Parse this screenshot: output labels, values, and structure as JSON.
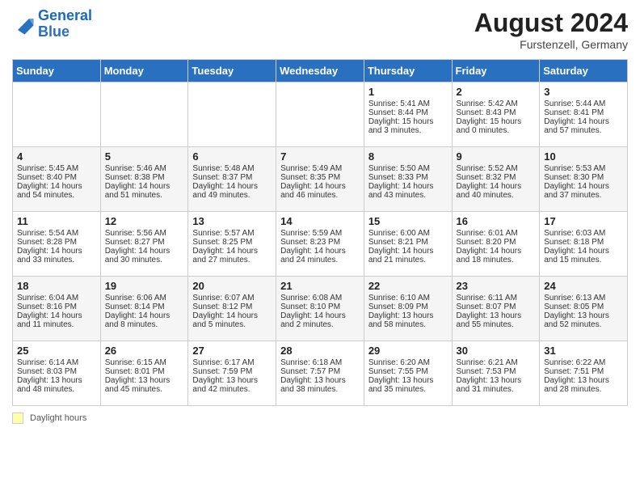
{
  "header": {
    "logo_general": "General",
    "logo_blue": "Blue",
    "month_year": "August 2024",
    "location": "Furstenzell, Germany"
  },
  "days_of_week": [
    "Sunday",
    "Monday",
    "Tuesday",
    "Wednesday",
    "Thursday",
    "Friday",
    "Saturday"
  ],
  "footer": {
    "label": "Daylight hours"
  },
  "weeks": [
    [
      {
        "day": "",
        "sunrise": "",
        "sunset": "",
        "daylight": ""
      },
      {
        "day": "",
        "sunrise": "",
        "sunset": "",
        "daylight": ""
      },
      {
        "day": "",
        "sunrise": "",
        "sunset": "",
        "daylight": ""
      },
      {
        "day": "",
        "sunrise": "",
        "sunset": "",
        "daylight": ""
      },
      {
        "day": "1",
        "sunrise": "Sunrise: 5:41 AM",
        "sunset": "Sunset: 8:44 PM",
        "daylight": "Daylight: 15 hours and 3 minutes."
      },
      {
        "day": "2",
        "sunrise": "Sunrise: 5:42 AM",
        "sunset": "Sunset: 8:43 PM",
        "daylight": "Daylight: 15 hours and 0 minutes."
      },
      {
        "day": "3",
        "sunrise": "Sunrise: 5:44 AM",
        "sunset": "Sunset: 8:41 PM",
        "daylight": "Daylight: 14 hours and 57 minutes."
      }
    ],
    [
      {
        "day": "4",
        "sunrise": "Sunrise: 5:45 AM",
        "sunset": "Sunset: 8:40 PM",
        "daylight": "Daylight: 14 hours and 54 minutes."
      },
      {
        "day": "5",
        "sunrise": "Sunrise: 5:46 AM",
        "sunset": "Sunset: 8:38 PM",
        "daylight": "Daylight: 14 hours and 51 minutes."
      },
      {
        "day": "6",
        "sunrise": "Sunrise: 5:48 AM",
        "sunset": "Sunset: 8:37 PM",
        "daylight": "Daylight: 14 hours and 49 minutes."
      },
      {
        "day": "7",
        "sunrise": "Sunrise: 5:49 AM",
        "sunset": "Sunset: 8:35 PM",
        "daylight": "Daylight: 14 hours and 46 minutes."
      },
      {
        "day": "8",
        "sunrise": "Sunrise: 5:50 AM",
        "sunset": "Sunset: 8:33 PM",
        "daylight": "Daylight: 14 hours and 43 minutes."
      },
      {
        "day": "9",
        "sunrise": "Sunrise: 5:52 AM",
        "sunset": "Sunset: 8:32 PM",
        "daylight": "Daylight: 14 hours and 40 minutes."
      },
      {
        "day": "10",
        "sunrise": "Sunrise: 5:53 AM",
        "sunset": "Sunset: 8:30 PM",
        "daylight": "Daylight: 14 hours and 37 minutes."
      }
    ],
    [
      {
        "day": "11",
        "sunrise": "Sunrise: 5:54 AM",
        "sunset": "Sunset: 8:28 PM",
        "daylight": "Daylight: 14 hours and 33 minutes."
      },
      {
        "day": "12",
        "sunrise": "Sunrise: 5:56 AM",
        "sunset": "Sunset: 8:27 PM",
        "daylight": "Daylight: 14 hours and 30 minutes."
      },
      {
        "day": "13",
        "sunrise": "Sunrise: 5:57 AM",
        "sunset": "Sunset: 8:25 PM",
        "daylight": "Daylight: 14 hours and 27 minutes."
      },
      {
        "day": "14",
        "sunrise": "Sunrise: 5:59 AM",
        "sunset": "Sunset: 8:23 PM",
        "daylight": "Daylight: 14 hours and 24 minutes."
      },
      {
        "day": "15",
        "sunrise": "Sunrise: 6:00 AM",
        "sunset": "Sunset: 8:21 PM",
        "daylight": "Daylight: 14 hours and 21 minutes."
      },
      {
        "day": "16",
        "sunrise": "Sunrise: 6:01 AM",
        "sunset": "Sunset: 8:20 PM",
        "daylight": "Daylight: 14 hours and 18 minutes."
      },
      {
        "day": "17",
        "sunrise": "Sunrise: 6:03 AM",
        "sunset": "Sunset: 8:18 PM",
        "daylight": "Daylight: 14 hours and 15 minutes."
      }
    ],
    [
      {
        "day": "18",
        "sunrise": "Sunrise: 6:04 AM",
        "sunset": "Sunset: 8:16 PM",
        "daylight": "Daylight: 14 hours and 11 minutes."
      },
      {
        "day": "19",
        "sunrise": "Sunrise: 6:06 AM",
        "sunset": "Sunset: 8:14 PM",
        "daylight": "Daylight: 14 hours and 8 minutes."
      },
      {
        "day": "20",
        "sunrise": "Sunrise: 6:07 AM",
        "sunset": "Sunset: 8:12 PM",
        "daylight": "Daylight: 14 hours and 5 minutes."
      },
      {
        "day": "21",
        "sunrise": "Sunrise: 6:08 AM",
        "sunset": "Sunset: 8:10 PM",
        "daylight": "Daylight: 14 hours and 2 minutes."
      },
      {
        "day": "22",
        "sunrise": "Sunrise: 6:10 AM",
        "sunset": "Sunset: 8:09 PM",
        "daylight": "Daylight: 13 hours and 58 minutes."
      },
      {
        "day": "23",
        "sunrise": "Sunrise: 6:11 AM",
        "sunset": "Sunset: 8:07 PM",
        "daylight": "Daylight: 13 hours and 55 minutes."
      },
      {
        "day": "24",
        "sunrise": "Sunrise: 6:13 AM",
        "sunset": "Sunset: 8:05 PM",
        "daylight": "Daylight: 13 hours and 52 minutes."
      }
    ],
    [
      {
        "day": "25",
        "sunrise": "Sunrise: 6:14 AM",
        "sunset": "Sunset: 8:03 PM",
        "daylight": "Daylight: 13 hours and 48 minutes."
      },
      {
        "day": "26",
        "sunrise": "Sunrise: 6:15 AM",
        "sunset": "Sunset: 8:01 PM",
        "daylight": "Daylight: 13 hours and 45 minutes."
      },
      {
        "day": "27",
        "sunrise": "Sunrise: 6:17 AM",
        "sunset": "Sunset: 7:59 PM",
        "daylight": "Daylight: 13 hours and 42 minutes."
      },
      {
        "day": "28",
        "sunrise": "Sunrise: 6:18 AM",
        "sunset": "Sunset: 7:57 PM",
        "daylight": "Daylight: 13 hours and 38 minutes."
      },
      {
        "day": "29",
        "sunrise": "Sunrise: 6:20 AM",
        "sunset": "Sunset: 7:55 PM",
        "daylight": "Daylight: 13 hours and 35 minutes."
      },
      {
        "day": "30",
        "sunrise": "Sunrise: 6:21 AM",
        "sunset": "Sunset: 7:53 PM",
        "daylight": "Daylight: 13 hours and 31 minutes."
      },
      {
        "day": "31",
        "sunrise": "Sunrise: 6:22 AM",
        "sunset": "Sunset: 7:51 PM",
        "daylight": "Daylight: 13 hours and 28 minutes."
      }
    ]
  ]
}
